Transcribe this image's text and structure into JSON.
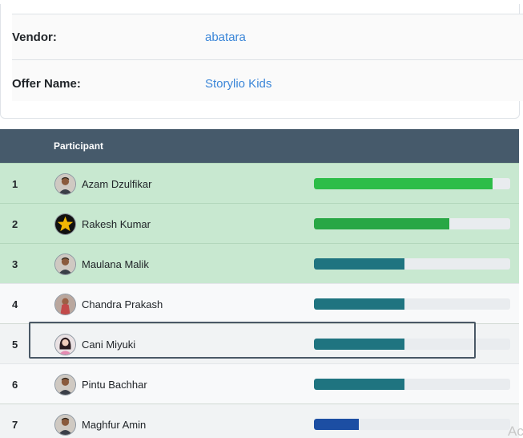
{
  "offer_info": {
    "vendor_label": "Vendor:",
    "vendor_value": "abatara",
    "offer_name_label": "Offer Name:",
    "offer_name_value": "Storylio Kids"
  },
  "table": {
    "header_participant": "Participant",
    "rows": [
      {
        "rank": "1",
        "name": "Azam Dzulfikar",
        "progress": 0.91,
        "bar_color": "#2dbd48",
        "avatar_icon": "man-avatar-icon"
      },
      {
        "rank": "2",
        "name": "Rakesh Kumar",
        "progress": 0.69,
        "bar_color": "#28a745",
        "avatar_icon": "star-avatar-icon"
      },
      {
        "rank": "3",
        "name": "Maulana Malik",
        "progress": 0.46,
        "bar_color": "#1f7480",
        "avatar_icon": "man-avatar-icon"
      },
      {
        "rank": "4",
        "name": "Chandra Prakash",
        "progress": 0.46,
        "bar_color": "#1f7480",
        "avatar_icon": "person-avatar-icon"
      },
      {
        "rank": "5",
        "name": "Cani Miyuki",
        "progress": 0.46,
        "bar_color": "#1f7480",
        "avatar_icon": "woman-avatar-icon"
      },
      {
        "rank": "6",
        "name": "Pintu Bachhar",
        "progress": 0.46,
        "bar_color": "#1f7480",
        "avatar_icon": "man-avatar-icon"
      },
      {
        "rank": "7",
        "name": "Maghfur Amin",
        "progress": 0.23,
        "bar_color": "#1c4ea3",
        "avatar_icon": "man-avatar-icon"
      }
    ]
  },
  "watermark_text": "Ac"
}
